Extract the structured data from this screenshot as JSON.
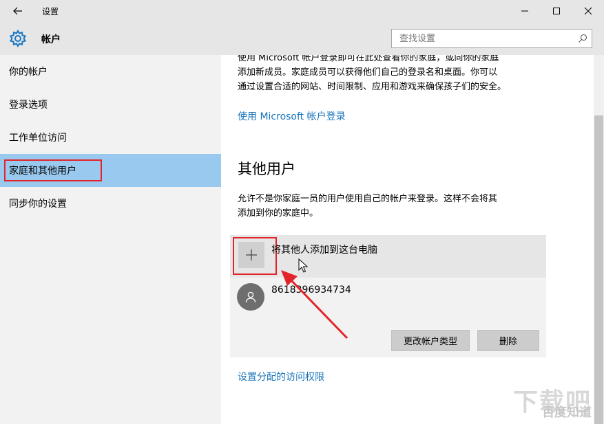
{
  "window": {
    "title": "设置",
    "back_icon": "arrow-left-icon",
    "controls": [
      "minimize-icon",
      "maximize-icon",
      "close-icon"
    ]
  },
  "header": {
    "icon": "gear-icon",
    "title": "帐户",
    "search_placeholder": "查找设置",
    "search_icon": "search-icon"
  },
  "sidebar": {
    "items": [
      {
        "label": "你的帐户"
      },
      {
        "label": "登录选项"
      },
      {
        "label": "工作单位访问"
      },
      {
        "label": "家庭和其他用户",
        "selected": true
      },
      {
        "label": "同步你的设置"
      }
    ],
    "accent": "#99c9ef"
  },
  "main": {
    "intro_lines": [
      "使用 Microsoft 帐户登录即可在此处查看你的家庭，或向你的家庭",
      "添加新成员。家庭成员可以获得他们自己的登录名和桌面。你可以",
      "通过设置合适的网站、时间限制、应用和游戏来确保孩子们的安全。"
    ],
    "ms_signin_link": "使用 Microsoft 帐户登录",
    "other_users_heading": "其他用户",
    "other_users_desc_lines": [
      "允许不是你家庭一员的用户使用自己的帐户来登录。这样不会将其",
      "添加到你的家庭中。"
    ],
    "add_user_label": "将其他人添加到这台电脑",
    "user": {
      "name": "8618396934734",
      "avatar_icon": "user-avatar-icon"
    },
    "change_type_button": "更改帐户类型",
    "delete_button": "删除",
    "assigned_access_link": "设置分配的访问权限"
  },
  "colors": {
    "link": "#1975bd",
    "annotation": "#e3232a"
  },
  "watermark": {
    "big": "下载吧",
    "small": "百度知道"
  }
}
